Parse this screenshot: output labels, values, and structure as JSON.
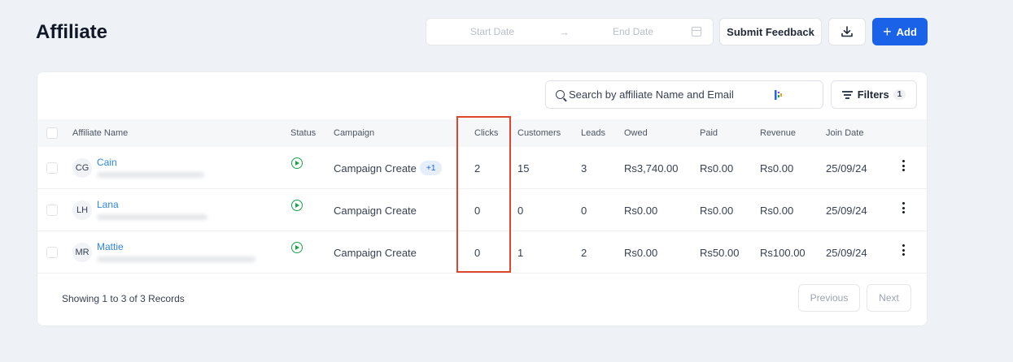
{
  "page": {
    "title": "Affiliate"
  },
  "toolbar": {
    "start_date_placeholder": "Start Date",
    "date_arrow": "→",
    "end_date_placeholder": "End Date",
    "calendar_icon": "calendar-icon",
    "feedback_label": "Submit Feedback",
    "download_icon": "download-icon",
    "add_label": "Add",
    "add_icon": "+",
    "accent_color": "#1a63e8"
  },
  "search": {
    "placeholder": "Search by affiliate Name and Email"
  },
  "filters": {
    "label": "Filters",
    "count": "1"
  },
  "table": {
    "columns": {
      "name": "Affiliate Name",
      "status": "Status",
      "campaign": "Campaign",
      "clicks": "Clicks",
      "customers": "Customers",
      "leads": "Leads",
      "owed": "Owed",
      "paid": "Paid",
      "revenue": "Revenue",
      "join_date": "Join Date"
    },
    "rows": [
      {
        "initials": "CG",
        "name": "Cain",
        "status": "active",
        "campaign": "Campaign Create",
        "campaign_extra": "+1",
        "clicks": "2",
        "customers": "15",
        "leads": "3",
        "owed": "Rs3,740.00",
        "paid": "Rs0.00",
        "revenue": "Rs0.00",
        "join_date": "25/09/24"
      },
      {
        "initials": "LH",
        "name": "Lana",
        "status": "active",
        "campaign": "Campaign Create",
        "campaign_extra": "",
        "clicks": "0",
        "customers": "0",
        "leads": "0",
        "owed": "Rs0.00",
        "paid": "Rs0.00",
        "revenue": "Rs0.00",
        "join_date": "25/09/24"
      },
      {
        "initials": "MR",
        "name": "Mattie",
        "status": "active",
        "campaign": "Campaign Create",
        "campaign_extra": "",
        "clicks": "0",
        "customers": "1",
        "leads": "2",
        "owed": "Rs0.00",
        "paid": "Rs50.00",
        "revenue": "Rs100.00",
        "join_date": "25/09/24"
      }
    ]
  },
  "pagination": {
    "records_text": "Showing 1 to 3 of 3 Records",
    "previous_label": "Previous",
    "next_label": "Next"
  },
  "highlight": {
    "color": "#e0452e"
  }
}
